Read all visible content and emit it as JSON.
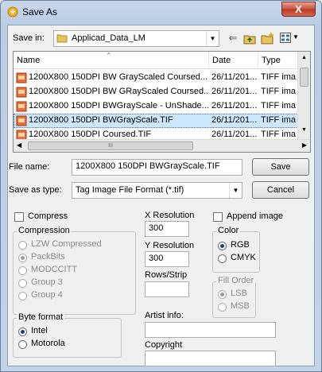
{
  "window": {
    "title": "Save As",
    "close_glyph": "X"
  },
  "toolbar": {
    "save_in_label": "Save in:",
    "save_in_value": "Applicad_Data_LM",
    "icons": [
      "back-arrow-icon",
      "up-folder-icon",
      "new-folder-icon",
      "view-menu-icon"
    ]
  },
  "file_list": {
    "columns": [
      "Name",
      "Date",
      "Type"
    ],
    "rows": [
      {
        "name": "1200X800 150DPI BW GrayScaled Coursed....",
        "date": "26/11/201...",
        "type": "TIFF ima",
        "selected": false
      },
      {
        "name": "1200X800 150DPI BW GRayScaled Coursed....",
        "date": "26/11/201...",
        "type": "TIFF ima",
        "selected": false
      },
      {
        "name": "1200X800 150DPI BWGrayScale - UnShade....",
        "date": "26/11/201...",
        "type": "TIFF ima",
        "selected": false
      },
      {
        "name": "1200X800 150DPI BWGrayScale.TIF",
        "date": "26/11/201...",
        "type": "TIFF ima",
        "selected": true
      },
      {
        "name": "1200X800 150DPI Coursed.TIF",
        "date": "26/11/201...",
        "type": "TIFF ima",
        "selected": false
      }
    ],
    "hscroll_grip": "III"
  },
  "file_name": {
    "label": "File name:",
    "value": "1200X800 150DPI BWGrayScale.TIF"
  },
  "save_as_type": {
    "label": "Save as type:",
    "value": "Tag Image File Format (*.tif)"
  },
  "buttons": {
    "save": "Save",
    "cancel": "Cancel"
  },
  "options": {
    "compress": {
      "label": "Compress",
      "checked": false
    },
    "compression": {
      "title": "Compression",
      "items": [
        {
          "label": "LZW Compressed",
          "selected": false
        },
        {
          "label": "PackBits",
          "selected": true
        },
        {
          "label": "MODCCITT",
          "selected": false
        },
        {
          "label": "Group 3",
          "selected": false
        },
        {
          "label": "Group 4",
          "selected": false
        }
      ]
    },
    "x_resolution": {
      "label": "X Resolution",
      "value": "300"
    },
    "y_resolution": {
      "label": "Y Resolution",
      "value": "300"
    },
    "rows_strip": {
      "label": "Rows/Strip",
      "value": ""
    },
    "append_image": {
      "label": "Append image",
      "checked": false
    },
    "color": {
      "title": "Color",
      "items": [
        {
          "label": "RGB",
          "selected": true
        },
        {
          "label": "CMYK",
          "selected": false
        }
      ]
    },
    "fill_order": {
      "title": "Fill Order",
      "items": [
        {
          "label": "LSB",
          "selected": true
        },
        {
          "label": "MSB",
          "selected": false
        }
      ]
    },
    "byte_format": {
      "title": "Byte format",
      "items": [
        {
          "label": "Intel",
          "selected": true
        },
        {
          "label": "Motorola",
          "selected": false
        }
      ]
    },
    "artist_info": {
      "label": "Artist info:",
      "value": ""
    },
    "copyright": {
      "label": "Copyright",
      "value": ""
    }
  }
}
